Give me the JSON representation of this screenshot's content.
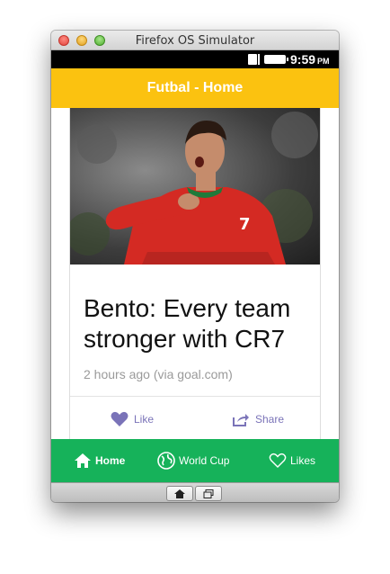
{
  "window": {
    "title": "Firefox OS Simulator"
  },
  "statusbar": {
    "time": "9:59",
    "ampm": "PM"
  },
  "app": {
    "title": "Futbal - Home"
  },
  "article": {
    "title": "Bento: Every team stronger with CR7",
    "meta": "2 hours ago (via goal.com)",
    "like_label": "Like",
    "share_label": "Share"
  },
  "tabs": [
    {
      "label": "Home",
      "icon": "home-icon"
    },
    {
      "label": "World Cup",
      "icon": "globe-icon"
    },
    {
      "label": "Likes",
      "icon": "heart-outline-icon"
    }
  ],
  "colors": {
    "header": "#fbc210",
    "tabbar": "#16b25a",
    "action": "#7a73b8",
    "jersey": "#d42a23"
  }
}
